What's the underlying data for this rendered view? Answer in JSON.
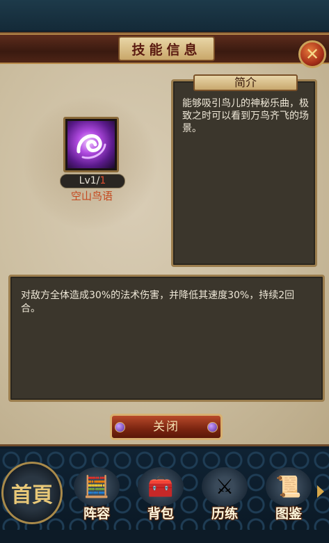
{
  "dialog": {
    "title": "技能信息",
    "close_icon": "close-x-icon"
  },
  "skill": {
    "level_prefix": "Lv1/",
    "level_max": "1",
    "name": "空山鸟语",
    "icon": "purple-swirl-skill-icon"
  },
  "intro": {
    "title": "简介",
    "text": "能够吸引鸟儿的神秘乐曲，极致之时可以看到万鸟齐飞的场景。"
  },
  "description": {
    "text": "对敌方全体造成30%的法术伤害，并降低其速度30%，持续2回合。"
  },
  "buttons": {
    "close_label": "关闭"
  },
  "nav": {
    "home_label": "首頁",
    "items": [
      {
        "label": "阵容",
        "icon": "abacus-icon"
      },
      {
        "label": "背包",
        "icon": "chest-icon"
      },
      {
        "label": "历练",
        "icon": "crossed-swords-icon"
      },
      {
        "label": "图鉴",
        "icon": "scroll-icon"
      }
    ]
  },
  "colors": {
    "accent_red": "#c4481e",
    "level_max": "#e35030",
    "text_light": "#efe8d8"
  }
}
